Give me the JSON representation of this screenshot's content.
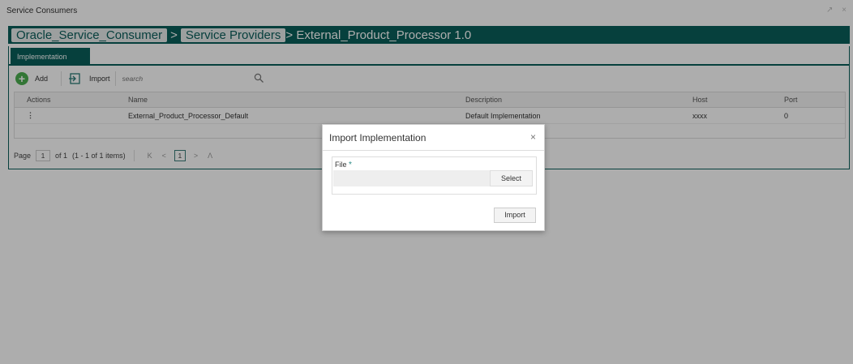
{
  "window": {
    "title": "Service Consumers",
    "controls": "↗ ×"
  },
  "breadcrumb": {
    "items": [
      "Oracle_Service_Consumer",
      "Service Providers"
    ],
    "separator": ">",
    "current": "> External_Product_Processor 1.0"
  },
  "tabs": [
    {
      "label": "Implementation",
      "active": true
    }
  ],
  "toolbar": {
    "add_label": "Add",
    "import_label": "Import",
    "search_placeholder": "search"
  },
  "table": {
    "columns": [
      "Actions",
      "Name",
      "Description",
      "Host",
      "Port"
    ],
    "rows": [
      {
        "actions": "⋮",
        "name": "External_Product_Processor_Default",
        "description": "Default Implementation",
        "host": "xxxx",
        "port": "0"
      }
    ]
  },
  "pagination": {
    "page_label": "Page",
    "page_value": "1",
    "of_label": "of 1",
    "items_info": "(1 - 1 of 1 items)",
    "first": "K",
    "prev": "<",
    "current": "1",
    "next": ">",
    "last": "Ʌ"
  },
  "modal": {
    "title": "Import Implementation",
    "close": "×",
    "file_label": "File",
    "required_mark": "*",
    "select_label": "Select",
    "import_label": "Import"
  },
  "colors": {
    "brand": "#0a5f5b",
    "add_icon": "#4caf50"
  }
}
